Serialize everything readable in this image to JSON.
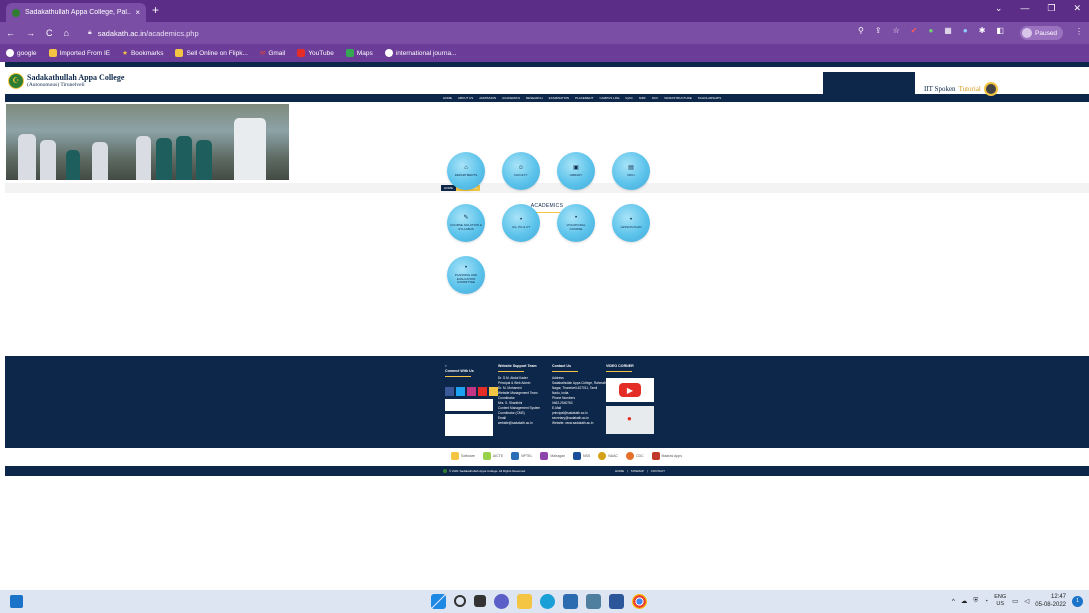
{
  "browser": {
    "tab_title": "Sadakathullah Appa College, Pal...",
    "tab_close": "×",
    "new_tab": "+",
    "url_domain": "sadakath.ac.in",
    "url_path": "/academics.php",
    "profile_label": "Paused",
    "bookmarks": [
      {
        "label": "google",
        "color": "#4a4a4a"
      },
      {
        "label": "Imported From IE",
        "color": "#f4c542"
      },
      {
        "label": "Bookmarks",
        "color": "#f4c542"
      },
      {
        "label": "Sell Online on Flipk...",
        "color": "#f4c542"
      },
      {
        "label": "Gmail",
        "color": "#ea4335"
      },
      {
        "label": "YouTube",
        "color": "#e52d27"
      },
      {
        "label": "Maps",
        "color": "#34a853"
      },
      {
        "label": "international journa...",
        "color": "#4a4a4a"
      }
    ]
  },
  "site": {
    "college_name": "Sadakathullah Appa College",
    "college_sub": "(Autonomous) Tirunelveli",
    "spoken_tutorial_1": "IIT Spoken",
    "spoken_tutorial_2": "Tutorial",
    "nav_items": [
      "HOME",
      "ABOUT US",
      "ADMISSION",
      "ACADEMICS",
      "RESEARCH",
      "EXAMINATION",
      "PLACEMENT",
      "CAMPUS LIFE",
      "IQAC",
      "NIRF",
      "NCC",
      "INFRASTRUCTURE",
      "SCHOLARSHIPS"
    ],
    "breadcrumb": {
      "home": "HOME",
      "current": "ACADEMICS"
    },
    "section_title": "ACADEMICS",
    "academic_items": [
      {
        "label": "DEPARTMENTS",
        "icon": "building-icon",
        "glyph": "⌂"
      },
      {
        "label": "FACULTY",
        "icon": "people-icon",
        "glyph": "☺"
      },
      {
        "label": "LIBRARY",
        "icon": "book-icon",
        "glyph": "▣"
      },
      {
        "label": "MOU",
        "icon": "document-icon",
        "glyph": "▤"
      },
      {
        "label": "COURSE SOLUTION & SYLLABUS",
        "icon": "edit-icon",
        "glyph": "✎"
      },
      {
        "label": "UG, PG & UT",
        "icon": "bullet-icon",
        "glyph": "•"
      },
      {
        "label": "VOCATIONAL COURSE",
        "icon": "bullet-icon",
        "glyph": "•"
      },
      {
        "label": "LESSON PLAN",
        "icon": "bullet-icon",
        "glyph": "•"
      },
      {
        "label": "PLANNING AND EVALUATION COMMITTEE",
        "icon": "bullet-icon",
        "glyph": "•"
      }
    ],
    "footer": {
      "connect_title": "Connect With Us",
      "support_title": "Website Support Team",
      "support_lines": [
        "Dr. S.M. Abdul Kader",
        "Principal & Web Admin",
        "Dr. M. Mohamed",
        "Website Management Team",
        "Coordinator",
        "Mrs. S. Shanthini",
        "Content Management System",
        "Coordinator (CMS)",
        "Email",
        "website@sadakath.ac.in"
      ],
      "contact_title": "Contact Us",
      "contact_lines": [
        "Address",
        "Sadakathullah Appa College, Rahmath",
        "Nagar, Tirunelveli-627011, Tamil",
        "Nadu, India.",
        "Phone Numbers",
        "0462-2540763",
        "E-Mail",
        "principal@sadakath.ac.in",
        "secretary@sadakath.ac.in",
        "Website: www.sadakath.ac.in"
      ],
      "video_title": "VIDEO CORNER"
    },
    "sponsors": [
      "Software",
      "AICTE",
      "NPTEL",
      "Mahagan",
      "NSS",
      "NAAC",
      "CDC",
      "Madras Apps"
    ],
    "copyright": "© 2021 Sadakathullah Appa College. All Rights Reserved.",
    "bottom_links": [
      "HOME",
      "SITEMAP",
      "CONTACT"
    ]
  },
  "taskbar": {
    "lang_1": "ENG",
    "lang_2": "US",
    "time": "12:47",
    "date": "05-08-2022",
    "notifications": "1"
  }
}
